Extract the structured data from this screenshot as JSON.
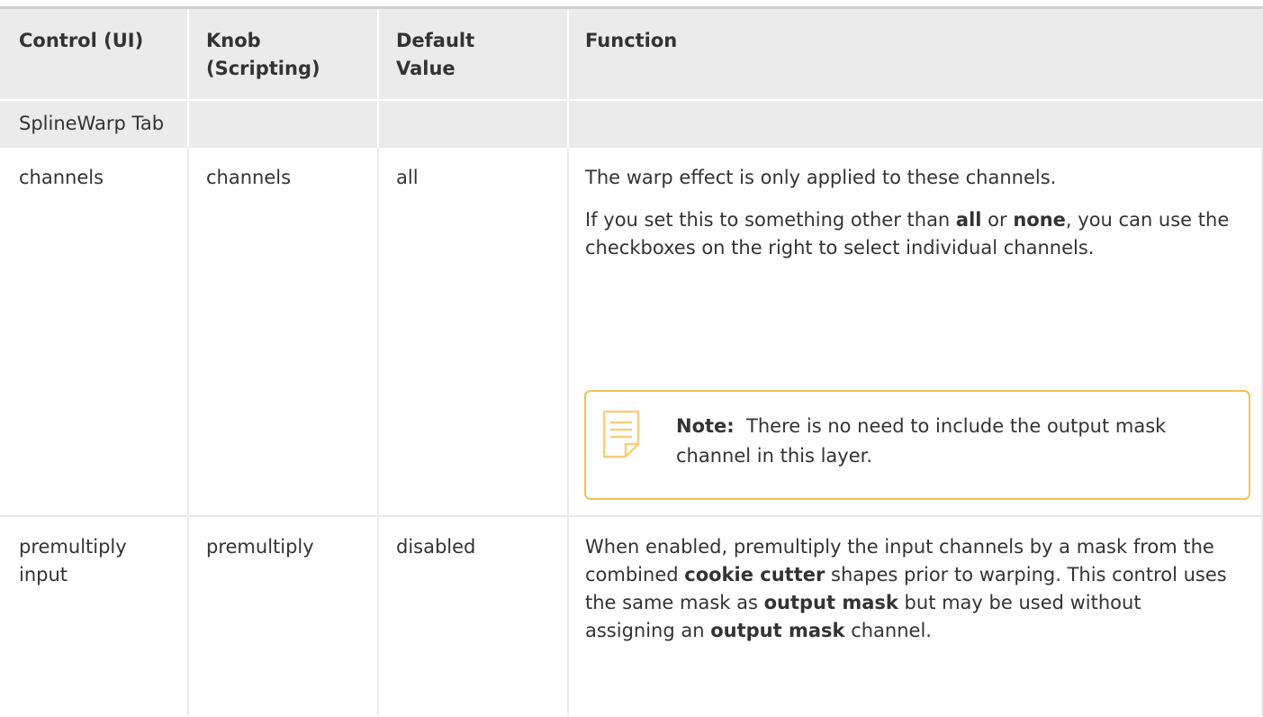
{
  "headers": {
    "control": "Control (UI)",
    "knob_line1": "Knob",
    "knob_line2": "(Scripting)",
    "default_line1": "Default",
    "default_line2": "Value",
    "function": "Function"
  },
  "section": {
    "title": "SplineWarp Tab"
  },
  "rows": [
    {
      "control": "channels",
      "knob": "channels",
      "default": "all",
      "function_p1": "The warp effect is only applied to these channels.",
      "function_p2_a": "If you set this to something other than ",
      "function_p2_b": "all",
      "function_p2_c": " or ",
      "function_p2_d": "none",
      "function_p2_e": ", you can use the checkboxes on the right to select individual channels.",
      "note_label": "Note:",
      "note_text": "  There is no need to include the output mask channel in this layer.",
      "note_icon": "note-icon"
    },
    {
      "control_line1": "premultiply",
      "control_line2": "input",
      "knob": "premultiply",
      "default": "disabled",
      "f_a": "When enabled, premultiply the input channels by a mask from the combined ",
      "f_b": "cookie cutter",
      "f_c": " shapes prior to warping. This control uses the same mask as ",
      "f_d": "output mask",
      "f_e": " but may be used without assigning an ",
      "f_f": "output mask",
      "f_g": " channel."
    }
  ],
  "colors": {
    "header_bg": "#ebebeb",
    "note_border": "#f2c14e",
    "text": "#333333"
  }
}
